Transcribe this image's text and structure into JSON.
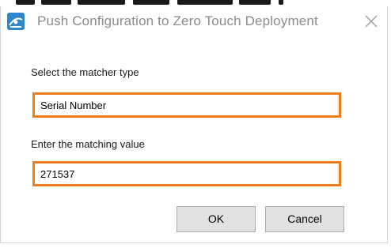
{
  "dialog": {
    "title": "Push Configuration to Zero Touch Deployment",
    "icon": "zero-touch-deployment-app-icon",
    "close_icon": "close-icon"
  },
  "matcher": {
    "label": "Select the matcher type",
    "value": "Serial Number"
  },
  "matching_value": {
    "label": "Enter the matching value",
    "value": "271537"
  },
  "buttons": {
    "ok": "OK",
    "cancel": "Cancel"
  },
  "colors": {
    "highlight_border": "#ef7d1d",
    "icon_blue": "#2d86c9",
    "title_text": "#8a8a8a",
    "button_face": "#e1e1e1"
  }
}
